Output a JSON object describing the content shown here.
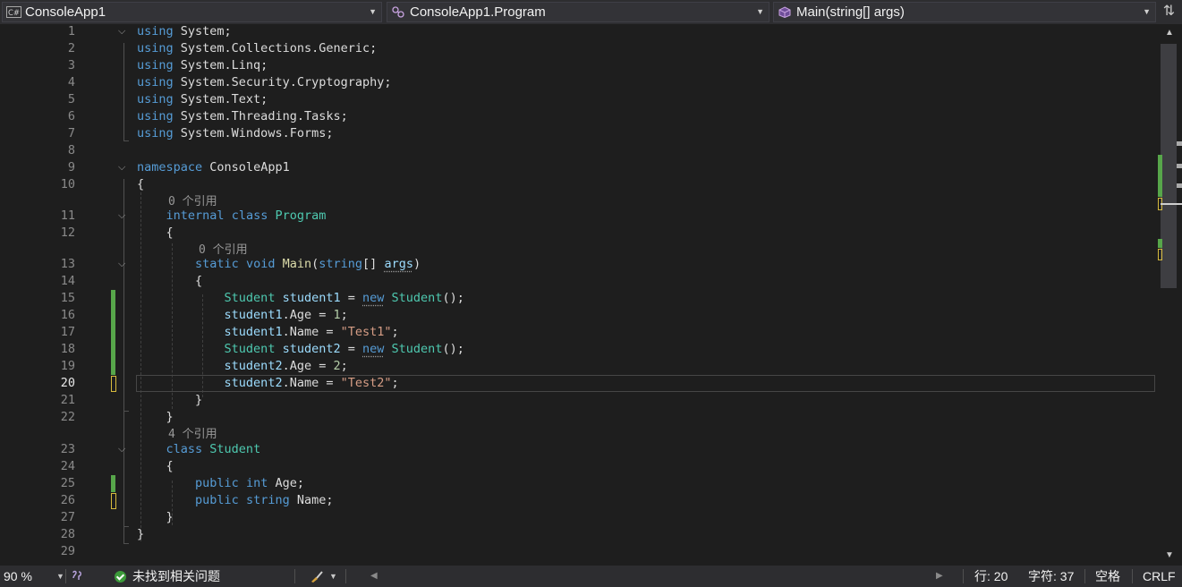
{
  "navigation": {
    "project_dropdown": "ConsoleApp1",
    "class_dropdown": "ConsoleApp1.Program",
    "member_dropdown": "Main(string[] args)"
  },
  "references": {
    "program_refs": "0 个引用",
    "main_refs": "0 个引用",
    "student_refs": "4 个引用"
  },
  "line_numbers": [
    "1",
    "2",
    "3",
    "4",
    "5",
    "6",
    "7",
    "8",
    "9",
    "10",
    "11",
    "12",
    "13",
    "14",
    "15",
    "16",
    "17",
    "18",
    "19",
    "20",
    "21",
    "22",
    "23",
    "24",
    "25",
    "26",
    "27",
    "28",
    "29"
  ],
  "current_line": "20",
  "code": {
    "kw_using": "using",
    "u1": "System;",
    "u2_a": "System.Collections.Generic;",
    "u3": "System.Linq;",
    "u4": "System.Security.Cryptography;",
    "u5": "System.Text;",
    "u6": "System.Threading.Tasks;",
    "u7": "System.Windows.Forms;",
    "kw_namespace": "namespace",
    "ns_name": "ConsoleApp1",
    "open_brace": "{",
    "close_brace": "}",
    "kw_internal": "internal",
    "kw_class": "class",
    "kw_static": "static",
    "kw_void": "void",
    "kw_string": "string",
    "kw_new": "new",
    "kw_public": "public",
    "kw_int": "int",
    "class_program": "Program",
    "class_student": "Student",
    "method_main": "Main",
    "param_args": "args",
    "var_student1": "student1",
    "var_student2": "student2",
    "field_age": "Age",
    "field_name": "Name",
    "val_age1": "1",
    "val_age2": "2",
    "val_name1": "\"Test1\"",
    "val_name2": "\"Test2\""
  },
  "status_bar": {
    "zoom": "90 %",
    "issues": "未找到相关问题",
    "line": "行: 20",
    "column": "字符: 37",
    "indent": "空格",
    "line_ending": "CRLF"
  },
  "colors": {
    "keyword": "#569cd6",
    "type": "#4ec9b0",
    "method": "#dcdcaa",
    "string": "#d69d85",
    "number": "#b5cea8",
    "variable": "#9cdcfe",
    "saved_change": "#57a64a",
    "unsaved_change": "#d7ba3d"
  }
}
